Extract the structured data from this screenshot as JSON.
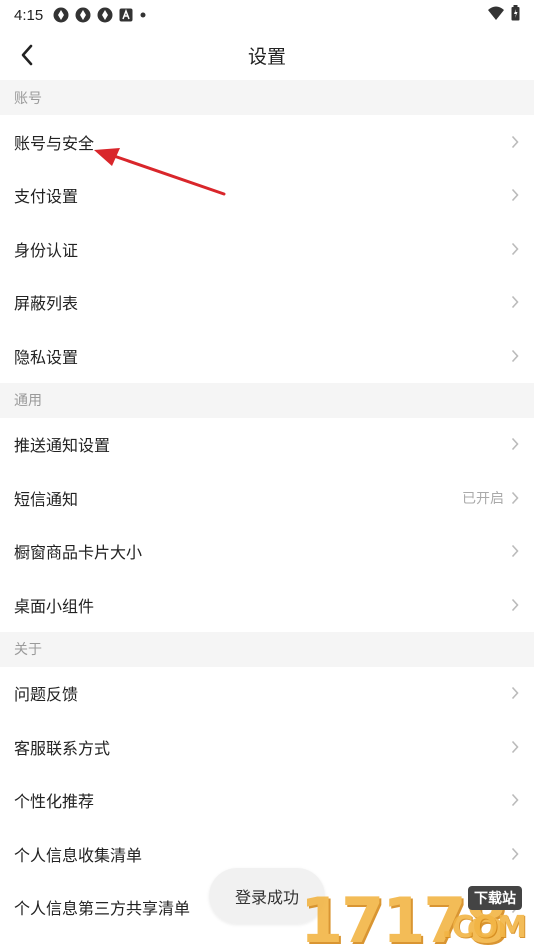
{
  "status_bar": {
    "time": "4:15",
    "left_icons": [
      "app-icon",
      "app-icon",
      "app-icon",
      "a-badge-icon",
      "dot-icon"
    ],
    "right_icons": [
      "wifi-icon",
      "battery-icon"
    ]
  },
  "nav": {
    "title": "设置",
    "back_icon": "chevron-left-icon"
  },
  "sections": [
    {
      "header": "账号",
      "items": [
        {
          "label": "账号与安全",
          "value": ""
        },
        {
          "label": "支付设置",
          "value": ""
        },
        {
          "label": "身份认证",
          "value": ""
        },
        {
          "label": "屏蔽列表",
          "value": ""
        },
        {
          "label": "隐私设置",
          "value": ""
        }
      ]
    },
    {
      "header": "通用",
      "items": [
        {
          "label": "推送通知设置",
          "value": ""
        },
        {
          "label": "短信通知",
          "value": "已开启"
        },
        {
          "label": "橱窗商品卡片大小",
          "value": ""
        },
        {
          "label": "桌面小组件",
          "value": ""
        }
      ]
    },
    {
      "header": "关于",
      "items": [
        {
          "label": "问题反馈",
          "value": ""
        },
        {
          "label": "客服联系方式",
          "value": ""
        },
        {
          "label": "个性化推荐",
          "value": ""
        },
        {
          "label": "个人信息收集清单",
          "value": ""
        },
        {
          "label": "个人信息第三方共享清单",
          "value": ""
        }
      ]
    }
  ],
  "toast": {
    "text": "登录成功"
  },
  "watermark": {
    "digits": "17178",
    "badge": "下载站",
    "com": ".COM"
  },
  "colors": {
    "section_bg": "#f5f5f5",
    "annotation_arrow": "#d9262b",
    "watermark": "#f2b545"
  }
}
